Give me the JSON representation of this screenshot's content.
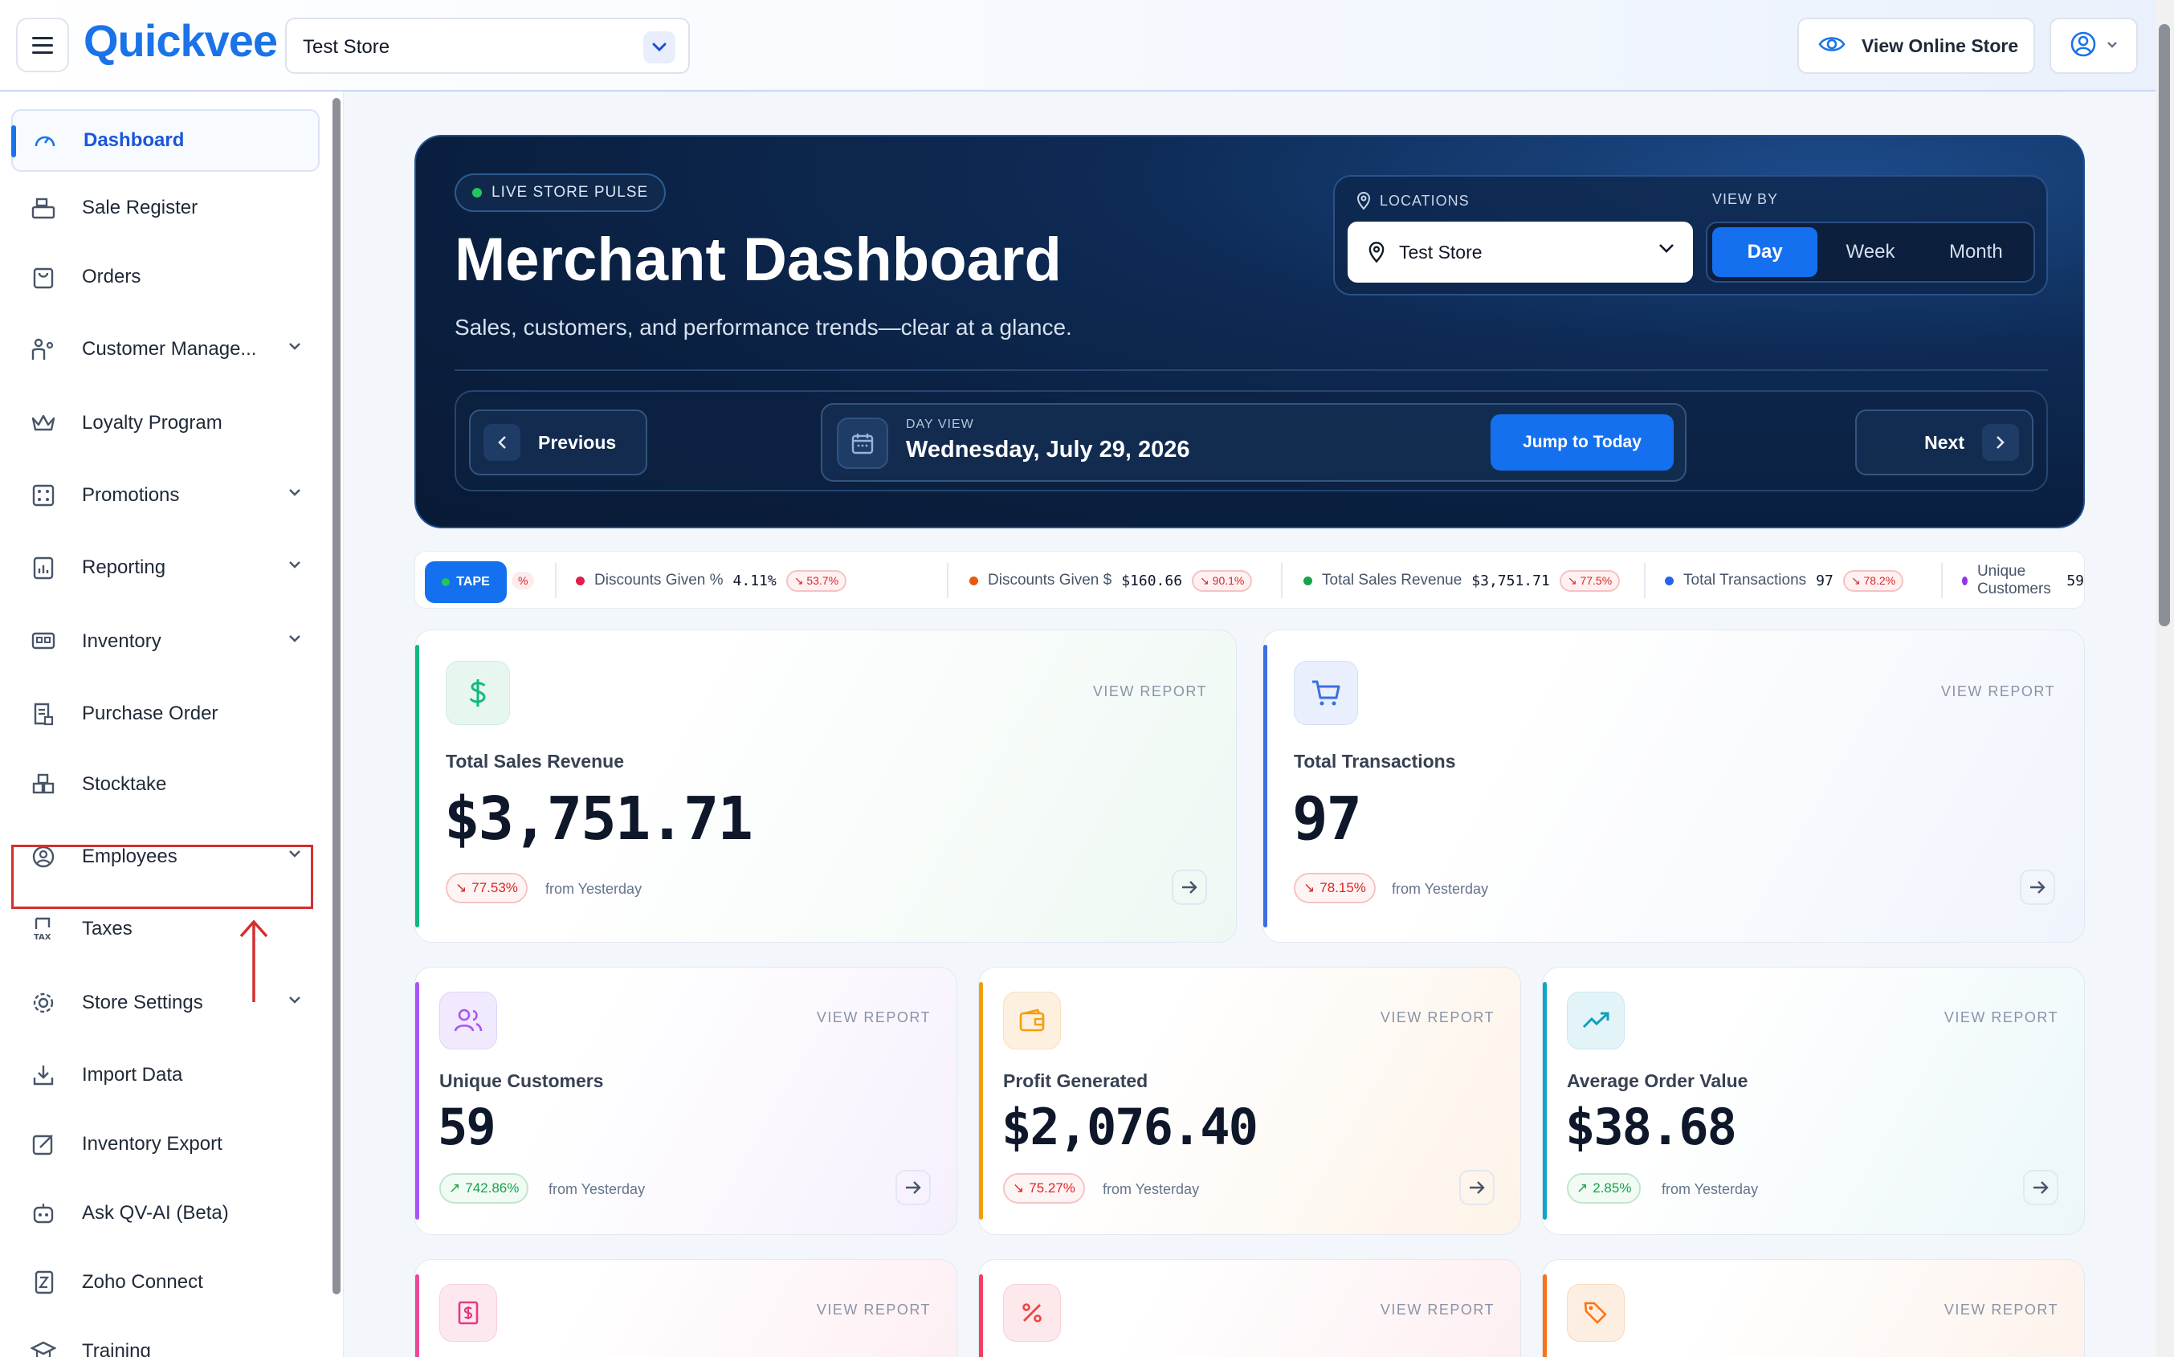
{
  "app": {
    "logo": "Quickvee"
  },
  "header": {
    "store_select": "Test Store",
    "view_online_store": "View Online Store"
  },
  "sidebar": {
    "items": [
      {
        "label": "Dashboard",
        "icon": "gauge-icon",
        "active": true
      },
      {
        "label": "Sale Register",
        "icon": "register-icon"
      },
      {
        "label": "Orders",
        "icon": "bag-icon"
      },
      {
        "label": "Customer Manage...",
        "icon": "customers-icon",
        "expandable": true
      },
      {
        "label": "Loyalty Program",
        "icon": "crown-icon"
      },
      {
        "label": "Promotions",
        "icon": "promotions-icon",
        "expandable": true
      },
      {
        "label": "Reporting",
        "icon": "report-icon",
        "expandable": true
      },
      {
        "label": "Inventory",
        "icon": "inventory-icon",
        "expandable": true
      },
      {
        "label": "Purchase Order",
        "icon": "purchase-order-icon"
      },
      {
        "label": "Stocktake",
        "icon": "stocktake-icon",
        "highlighted": true
      },
      {
        "label": "Employees",
        "icon": "employee-icon",
        "expandable": true
      },
      {
        "label": "Taxes",
        "icon": "tax-icon"
      },
      {
        "label": "Store Settings",
        "icon": "gear-icon",
        "expandable": true
      },
      {
        "label": "Import Data",
        "icon": "download-icon"
      },
      {
        "label": "Inventory Export",
        "icon": "export-icon"
      },
      {
        "label": "Ask QV-AI (Beta)",
        "icon": "robot-icon"
      },
      {
        "label": "Zoho Connect",
        "icon": "zoho-icon"
      },
      {
        "label": "Training",
        "icon": "training-icon"
      }
    ]
  },
  "hero": {
    "pulse": "LIVE STORE PULSE",
    "title": "Merchant Dashboard",
    "subtitle": "Sales, customers, and performance trends—clear at a glance.",
    "locations_label": "LOCATIONS",
    "location_value": "Test Store",
    "view_by_label": "VIEW BY",
    "view_by_options": [
      "Day",
      "Week",
      "Month"
    ],
    "view_by_selected": "Day",
    "previous": "Previous",
    "next": "Next",
    "day_view_label": "DAY VIEW",
    "date": "Wednesday, July 29, 2026",
    "jump_today": "Jump to Today"
  },
  "ticker": {
    "tape_label": "TAPE",
    "partial": "%",
    "items": [
      {
        "label": "Discounts Given %",
        "value": "4.11%",
        "change": "53.7%",
        "color": "#e11d48"
      },
      {
        "label": "Discounts Given $",
        "value": "$160.66",
        "change": "90.1%",
        "color": "#ea580c"
      },
      {
        "label": "Total Sales Revenue",
        "value": "$3,751.71",
        "change": "77.5%",
        "color": "#16a34a"
      },
      {
        "label": "Total Transactions",
        "value": "97",
        "change": "78.2%",
        "color": "#2563eb"
      },
      {
        "label": "Unique Customers",
        "value": "59",
        "change": "",
        "color": "#9333ea"
      }
    ]
  },
  "cards": {
    "view_report": "VIEW REPORT",
    "from": "from Yesterday",
    "revenue": {
      "title": "Total Sales Revenue",
      "value": "$3,751.71",
      "change": "77.53%",
      "trend": "down",
      "color": "#10b981"
    },
    "transactions": {
      "title": "Total Transactions",
      "value": "97",
      "change": "78.15%",
      "trend": "down",
      "color": "#3b6fe0"
    },
    "customers": {
      "title": "Unique Customers",
      "value": "59",
      "change": "742.86%",
      "trend": "up",
      "color": "#a855f7"
    },
    "profit": {
      "title": "Profit Generated",
      "value": "$2,076.40",
      "change": "75.27%",
      "trend": "down",
      "color": "#f59e0b"
    },
    "aov": {
      "title": "Average Order Value",
      "value": "$38.68",
      "change": "2.85%",
      "trend": "up",
      "color": "#0ea5c6"
    }
  }
}
